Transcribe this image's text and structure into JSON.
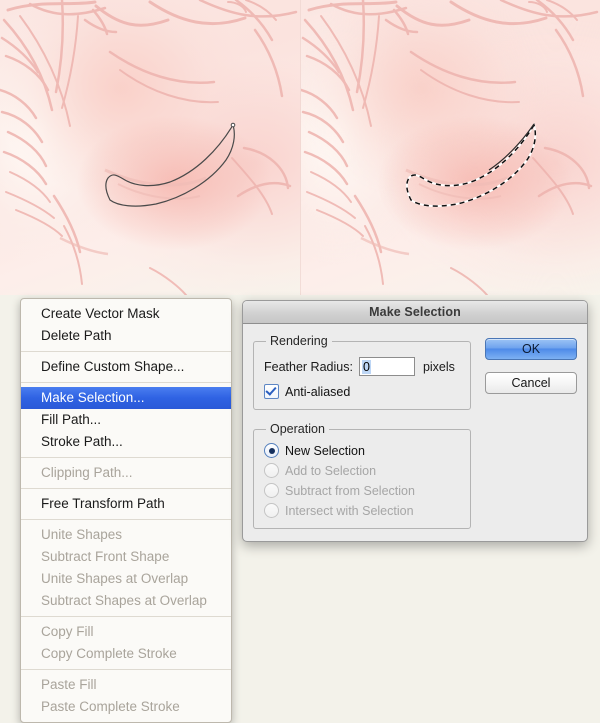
{
  "artwork": {
    "description": "pale pink digital painting of a face in profile, eye area",
    "left_pane_label": "path outline view",
    "right_pane_label": "marching ants selection view",
    "path_stroke_color": "#4a4a4a",
    "base_color": "#fbe6e2"
  },
  "context_menu": {
    "groups": [
      {
        "items": [
          {
            "label": "Create Vector Mask",
            "state": "enabled"
          },
          {
            "label": "Delete Path",
            "state": "enabled"
          }
        ]
      },
      {
        "items": [
          {
            "label": "Define Custom Shape...",
            "state": "enabled"
          }
        ]
      },
      {
        "items": [
          {
            "label": "Make Selection...",
            "state": "selected"
          },
          {
            "label": "Fill Path...",
            "state": "enabled"
          },
          {
            "label": "Stroke Path...",
            "state": "enabled"
          }
        ]
      },
      {
        "items": [
          {
            "label": "Clipping Path...",
            "state": "disabled"
          }
        ]
      },
      {
        "items": [
          {
            "label": "Free Transform Path",
            "state": "enabled"
          }
        ]
      },
      {
        "items": [
          {
            "label": "Unite Shapes",
            "state": "disabled"
          },
          {
            "label": "Subtract Front Shape",
            "state": "disabled"
          },
          {
            "label": "Unite Shapes at Overlap",
            "state": "disabled"
          },
          {
            "label": "Subtract Shapes at Overlap",
            "state": "disabled"
          }
        ]
      },
      {
        "items": [
          {
            "label": "Copy Fill",
            "state": "disabled"
          },
          {
            "label": "Copy Complete Stroke",
            "state": "disabled"
          }
        ]
      },
      {
        "items": [
          {
            "label": "Paste Fill",
            "state": "disabled"
          },
          {
            "label": "Paste Complete Stroke",
            "state": "disabled"
          }
        ]
      }
    ],
    "highlight_color": "#2f62e3"
  },
  "dialog": {
    "title": "Make Selection",
    "rendering": {
      "legend": "Rendering",
      "feather_label": "Feather Radius:",
      "feather_value": "0",
      "feather_unit": "pixels",
      "antialiased_label": "Anti-aliased",
      "antialiased_checked": true
    },
    "operation": {
      "legend": "Operation",
      "options": [
        {
          "label": "New Selection",
          "selected": true,
          "enabled": true
        },
        {
          "label": "Add to Selection",
          "selected": false,
          "enabled": false
        },
        {
          "label": "Subtract from Selection",
          "selected": false,
          "enabled": false
        },
        {
          "label": "Intersect with Selection",
          "selected": false,
          "enabled": false
        }
      ]
    },
    "buttons": {
      "ok_label": "OK",
      "cancel_label": "Cancel",
      "default_button_color": "#4e8ae8"
    }
  }
}
